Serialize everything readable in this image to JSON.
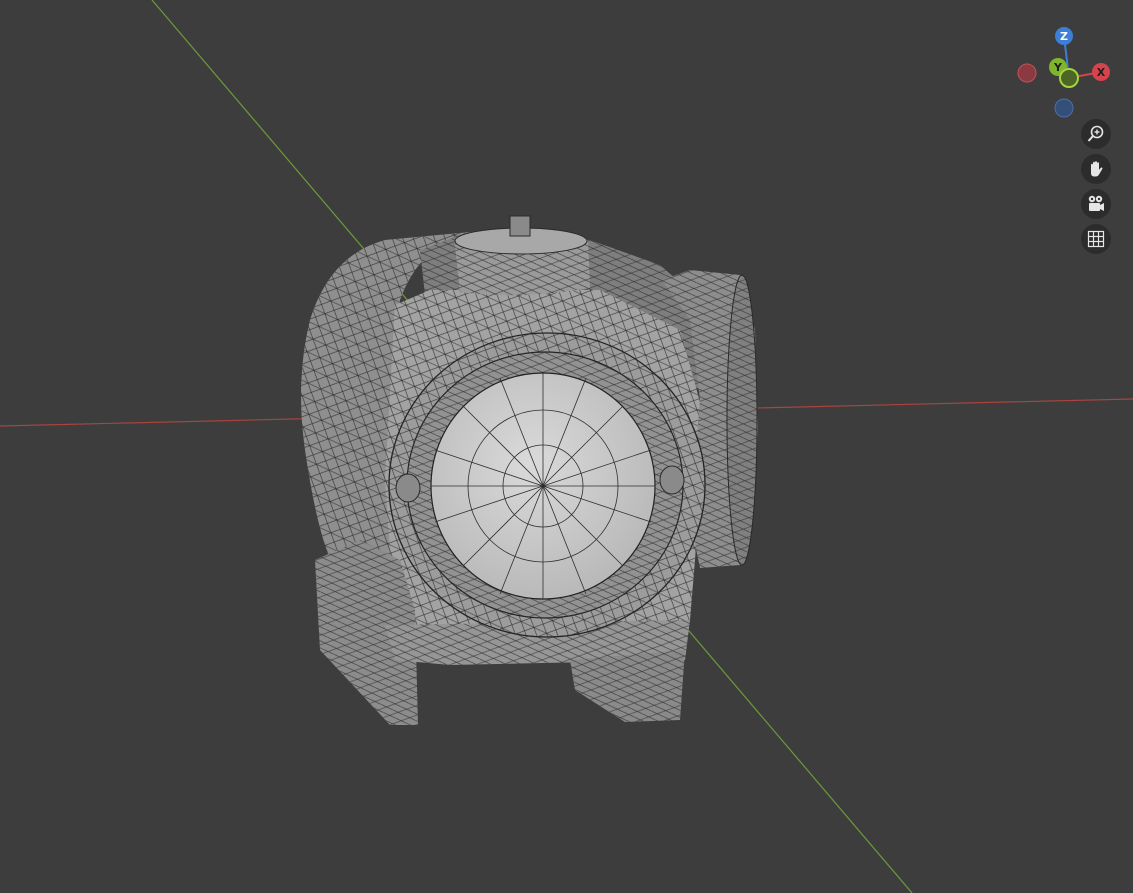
{
  "viewport": {
    "background": "#3d3d3d",
    "x_axis_color": "#a8453f",
    "y_axis_color": "#6d9a3a",
    "object": "mesh-wireframe"
  },
  "gizmo": {
    "z_label": "Z",
    "y_label": "Y",
    "x_label": "X",
    "z_color": "#3d7fd6",
    "y_color": "#7fb52b",
    "x_color": "#d6434d"
  },
  "navigation": {
    "zoom_icon": "zoom-icon",
    "pan_icon": "hand-icon",
    "camera_icon": "camera-icon",
    "grid_icon": "grid-icon"
  }
}
